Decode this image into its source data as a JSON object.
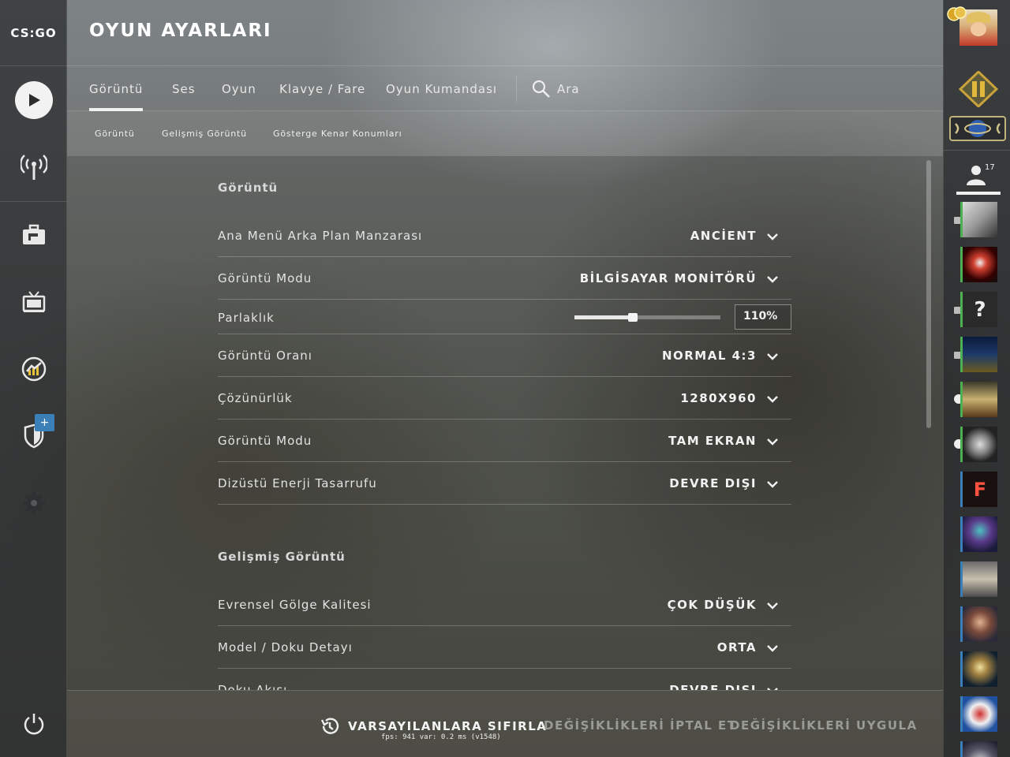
{
  "app": {
    "logo": "CS:GO",
    "title": "OYUN AYARLARI"
  },
  "tabs": [
    {
      "label": "Görüntü",
      "active": true
    },
    {
      "label": "Ses"
    },
    {
      "label": "Oyun"
    },
    {
      "label": "Klavye / Fare"
    },
    {
      "label": "Oyun Kumandası"
    }
  ],
  "search": {
    "label": "Ara",
    "icon": "search-icon"
  },
  "subtabs": [
    "Görüntü",
    "Gelişmiş Görüntü",
    "Gösterge Kenar Konumları"
  ],
  "sections": [
    {
      "title": "Görüntü",
      "rows": [
        {
          "label": "Ana Menü Arka Plan Manzarası",
          "value": "ANCİENT"
        },
        {
          "label": "Görüntü Modu",
          "value": "BİLGİSAYAR MONİTÖRÜ"
        },
        {
          "label": "Parlaklık",
          "value": "110%",
          "slider_fraction": 0.4
        },
        {
          "label": "Görüntü Oranı",
          "value": "NORMAL 4:3"
        },
        {
          "label": "Çözünürlük",
          "value": "1280X960"
        },
        {
          "label": "Görüntü Modu",
          "value": "TAM EKRAN"
        },
        {
          "label": "Dizüstü Enerji Tasarrufu",
          "value": "DEVRE DIŞI"
        }
      ]
    },
    {
      "title": "Gelişmiş Görüntü",
      "rows": [
        {
          "label": "Evrensel Gölge Kalitesi",
          "value": "ÇOK DÜŞÜK"
        },
        {
          "label": "Model / Doku Detayı",
          "value": "ORTA"
        },
        {
          "label": "Doku Akışı",
          "value": "DEVRE DIŞI"
        }
      ]
    }
  ],
  "footer": {
    "reset": "VARSAYILANLARA SIFIRLA",
    "cancel": "DEĞİŞİKLİKLERİ İPTAL ET",
    "apply": "DEĞİŞİKLİKLERİ UYGULA",
    "fps": "fps:   941 var:  0.2 ms (v1548)"
  },
  "friends": {
    "count": "17"
  },
  "colors": {
    "accent": "#f0f0f0",
    "online": "#4caf50",
    "badge": "#3a7fb8",
    "disabled_text": "#9a9a96"
  }
}
